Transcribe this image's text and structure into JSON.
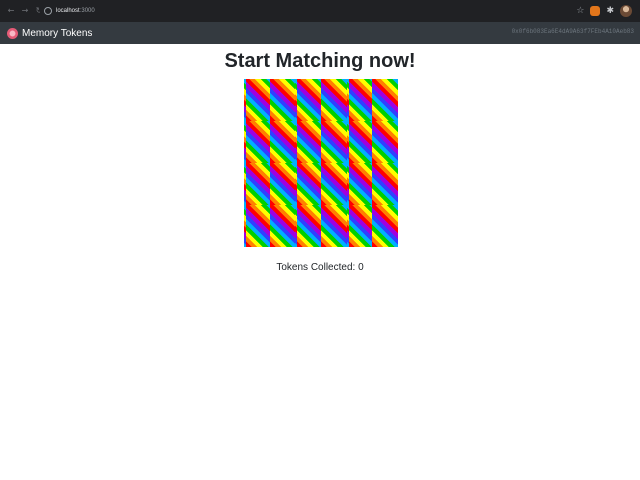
{
  "browser": {
    "url_host": "localhost",
    "url_port": ":3000"
  },
  "navbar": {
    "brand": "Memory Tokens",
    "account": "0x0f6b083Ea6E4dA9A63f7FEb4A10Aeb83"
  },
  "main": {
    "title": "Start Matching now!",
    "tokens_label": "Tokens Collected: 0",
    "card_count": 24
  },
  "colors": {
    "chrome_bg": "#202124",
    "navbar_bg": "#343a40",
    "card_pattern": [
      "#ff0000",
      "#ff8000",
      "#ffff00",
      "#00d000",
      "#00b0ff",
      "#3040ff",
      "#a000e0"
    ]
  }
}
